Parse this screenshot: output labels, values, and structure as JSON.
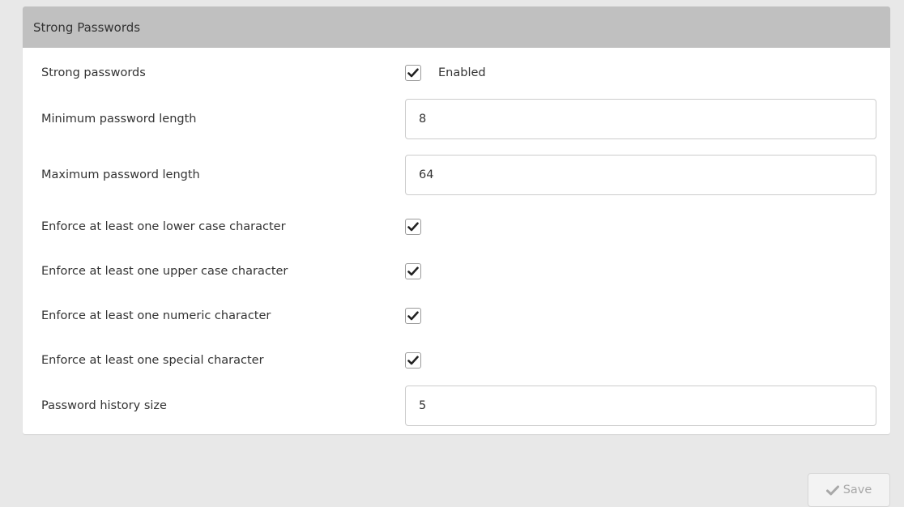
{
  "panel": {
    "title": "Strong Passwords"
  },
  "fields": {
    "strong_passwords": {
      "label": "Strong passwords",
      "checked": true,
      "checkbox_label": "Enabled"
    },
    "min_length": {
      "label": "Minimum password length",
      "value": "8"
    },
    "max_length": {
      "label": "Maximum password length",
      "value": "64"
    },
    "lower_case": {
      "label": "Enforce at least one lower case character",
      "checked": true
    },
    "upper_case": {
      "label": "Enforce at least one upper case character",
      "checked": true
    },
    "numeric": {
      "label": "Enforce at least one numeric character",
      "checked": true
    },
    "special": {
      "label": "Enforce at least one special character",
      "checked": true
    },
    "history_size": {
      "label": "Password history size",
      "value": "5"
    }
  },
  "actions": {
    "save_label": "Save",
    "save_icon": "check-icon",
    "save_disabled": true
  },
  "colors": {
    "page_background": "#e8e8e8",
    "panel_header": "#c0c0c0",
    "panel_background": "#ffffff",
    "text": "#333333",
    "disabled_text": "#a8a8a8"
  }
}
